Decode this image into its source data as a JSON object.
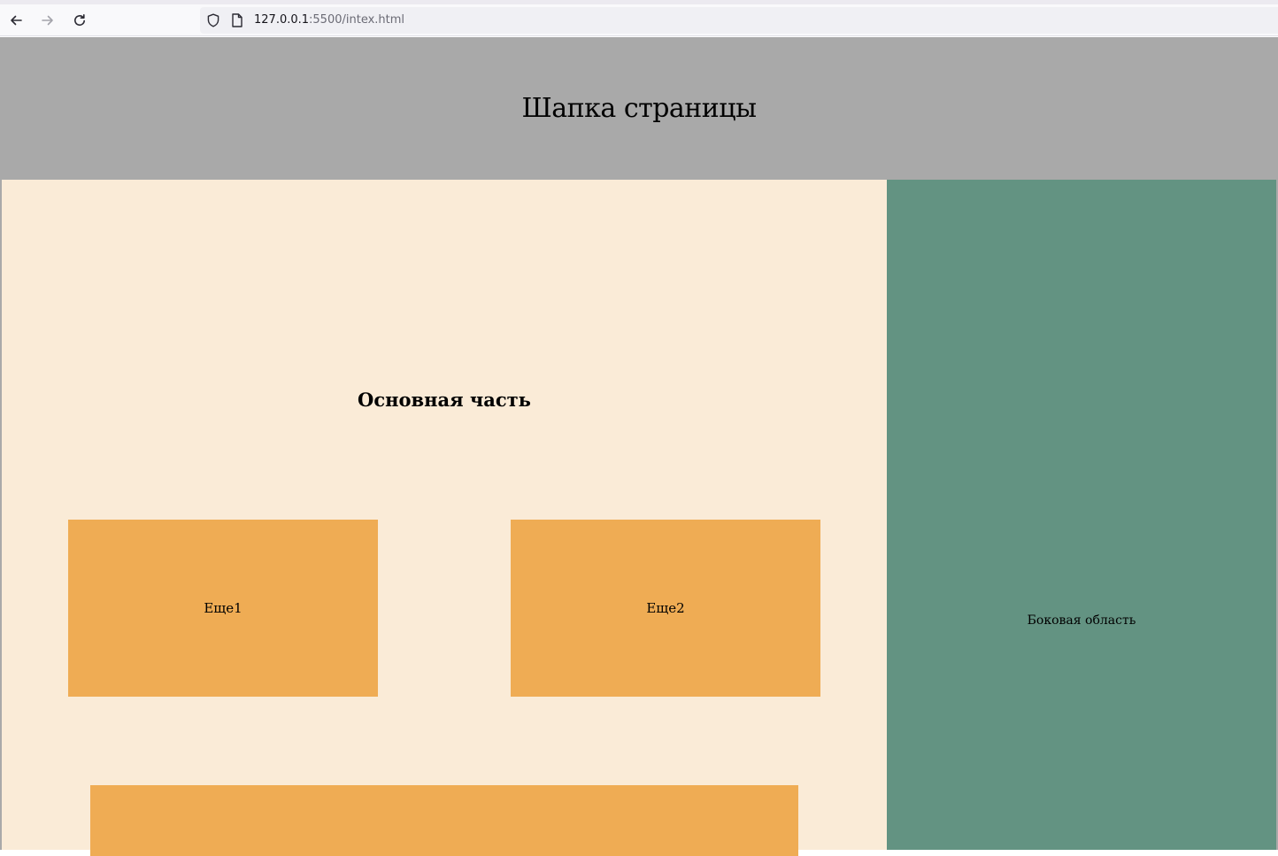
{
  "browser": {
    "url_host": "127.0.0.1",
    "url_path": ":5500/intex.html",
    "nav_icons": [
      "back-arrow-icon",
      "forward-arrow-icon",
      "reload-icon"
    ],
    "url_icons": [
      "shield-icon",
      "page-icon"
    ]
  },
  "page": {
    "header": {
      "title": "Шапка страницы",
      "background": "#a9a9a9"
    },
    "main": {
      "title": "Основная часть",
      "background": "#faebd7",
      "cards": [
        {
          "label": "Еще1",
          "background": "#efac54"
        },
        {
          "label": "Еще2",
          "background": "#efac54"
        }
      ],
      "wide_block": {
        "label": "",
        "background": "#efac54"
      }
    },
    "sidebar": {
      "label": "Боковая область",
      "background": "#639382"
    }
  }
}
